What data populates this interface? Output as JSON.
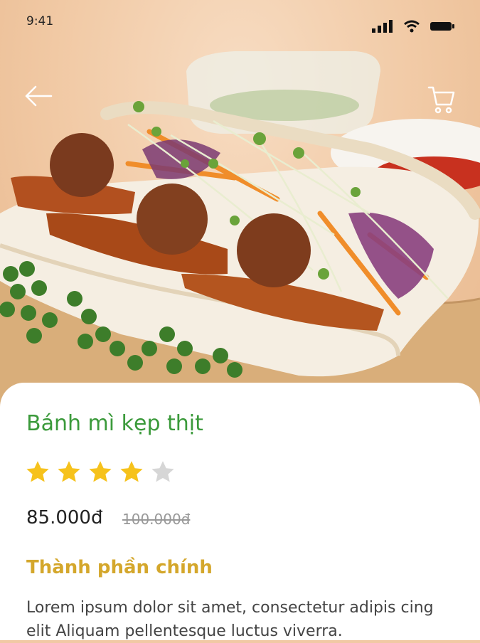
{
  "status_bar": {
    "time": "9:41"
  },
  "product": {
    "name": "Bánh mì kẹp thịt",
    "rating": 4,
    "rating_max": 5,
    "price": "85.000đ",
    "old_price": "100.000đ"
  },
  "ingredients": {
    "title": "Thành phần chính",
    "text": "Lorem ipsum dolor sit amet, consectetur adipis cing elit Aliquam pellentesque luctus viverra."
  },
  "colors": {
    "title_green": "#3b9a3b",
    "section_gold": "#d4a72c",
    "star_filled": "#f6c21c",
    "star_empty": "#d6d6d6"
  }
}
